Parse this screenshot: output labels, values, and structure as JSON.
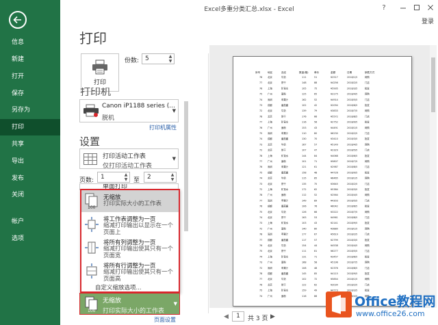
{
  "window": {
    "title": "Excel多重分类汇总.xlsx - Excel",
    "login": "登录"
  },
  "nav": {
    "items": [
      {
        "label": "信息"
      },
      {
        "label": "新建"
      },
      {
        "label": "打开"
      },
      {
        "label": "保存"
      },
      {
        "label": "另存为"
      },
      {
        "label": "打印",
        "active": true
      },
      {
        "label": "共享"
      },
      {
        "label": "导出"
      },
      {
        "label": "发布"
      },
      {
        "label": "关闭"
      },
      {
        "label": "帐户"
      },
      {
        "label": "选项"
      }
    ]
  },
  "print": {
    "heading": "打印",
    "button_label": "打印",
    "copies_label": "份数:",
    "copies_value": "5"
  },
  "printer": {
    "heading": "打印机",
    "name": "Canon iP1188 series (...",
    "status": "脱机",
    "properties_link": "打印机属性"
  },
  "settings": {
    "heading": "设置",
    "scope_title": "打印活动工作表",
    "scope_sub": "仅打印活动工作表",
    "pages_label": "页数:",
    "page_from": "1",
    "to_label": "至",
    "page_to": "2",
    "collated_peek": "单面打印",
    "scaling_options": [
      {
        "title": "无缩放",
        "desc": "打印实际大小的工作表",
        "selected": true
      },
      {
        "title": "将工作表调整为一页",
        "desc": "缩减打印输出以显示在一个页面上"
      },
      {
        "title": "将所有列调整为一页",
        "desc": "缩减打印输出使其只有一个页面宽"
      },
      {
        "title": "将所有行调整为一页",
        "desc": "缩减打印输出使其只有一个页面高"
      }
    ],
    "custom_scaling": "自定义缩放选项...",
    "current_scaling_title": "无缩放",
    "current_scaling_sub": "打印实际大小的工作表",
    "page_setup_link": "页面设置"
  },
  "preview": {
    "current_page": "1",
    "total_pages": "共 3 页",
    "header_row": [
      "序号",
      "地区",
      "品名",
      "数量(箱)",
      "单价",
      "金额",
      "日期",
      "销售方式"
    ],
    "col_values": {
      "region": [
        "北京",
        "北京",
        "上海",
        "广州",
        "深圳",
        "成都"
      ],
      "product": [
        "苹果汁",
        "番茄酱",
        "牛奶",
        "饼干",
        "矿泉水",
        "面粉"
      ],
      "method": [
        "网购",
        "门店",
        "批发"
      ]
    }
  },
  "watermark": {
    "name": "Office教程网",
    "url": "www.office26.com"
  },
  "colors": {
    "nav_green": "#217346",
    "nav_active": "#0f4f2c",
    "highlight_red": "#d9262c",
    "selected_green": "#7ba767",
    "link_blue": "#2a5fa8"
  }
}
